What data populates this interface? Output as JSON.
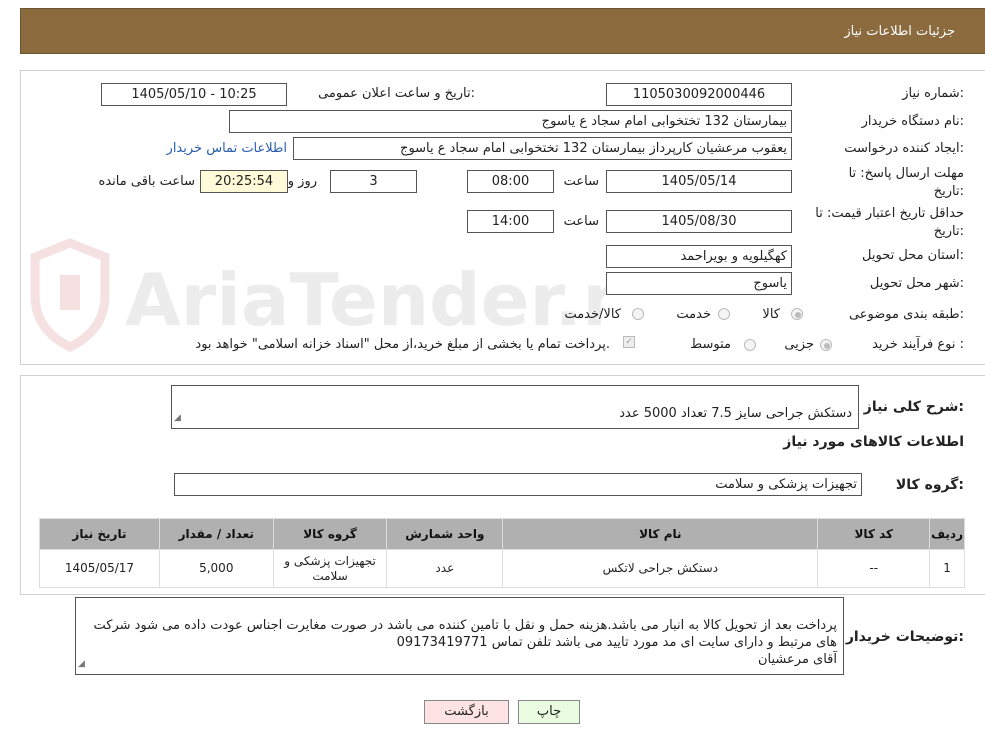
{
  "header": {
    "title": "جزئیات اطلاعات نیاز"
  },
  "watermark": {
    "text": "AriaTender.neT"
  },
  "form": {
    "need_number": {
      "label": "شماره نیاز:",
      "value": "1105030092000446"
    },
    "announce": {
      "label": "تاریخ و ساعت اعلان عمومی:",
      "value": "1405/05/10 - 10:25"
    },
    "buyer_org": {
      "label": "نام دستگاه خریدار:",
      "value": "بیمارستان 132 تختخوابی امام سجاد  ع  یاسوج"
    },
    "requester": {
      "label": "ایجاد کننده درخواست:",
      "value": "یعقوب مرعشیان کارپرداز بیمارستان 132 تختخوابی امام سجاد  ع  یاسوج",
      "contact_link": "اطلاعات تماس خریدار"
    },
    "deadline": {
      "label_line1": "مهلت ارسال پاسخ: تا",
      "label_line2": "تاریخ:",
      "date": "1405/05/14",
      "time_label": "ساعت",
      "time": "08:00",
      "days": "3",
      "days_label": "روز و",
      "remaining": "20:25:54",
      "remaining_label": "ساعت باقی مانده"
    },
    "validity": {
      "label_line1": "حداقل تاریخ اعتبار قیمت: تا",
      "label_line2": "تاریخ:",
      "date": "1405/08/30",
      "time_label": "ساعت",
      "time": "14:00"
    },
    "province": {
      "label": "استان محل تحویل:",
      "value": "کهگیلویه و بویراحمد"
    },
    "city": {
      "label": "شهر محل تحویل:",
      "value": "یاسوج"
    },
    "category": {
      "label": "طبقه بندی موضوعی:",
      "options": [
        "کالا",
        "خدمت",
        "کالا/خدمت"
      ],
      "selected": "کالا"
    },
    "process": {
      "label": "نوع فرآیند خرید :",
      "options": [
        "جزیی",
        "متوسط"
      ],
      "selected": "جزیی",
      "treasury_note": "پرداخت تمام یا بخشی از مبلغ خرید،از محل \"اسناد خزانه اسلامی\" خواهد بود."
    }
  },
  "description": {
    "label": "شرح کلی نیاز:",
    "value": "دستکش جراحی سایز 7.5  تعداد 5000 عدد"
  },
  "goods_info": {
    "title": "اطلاعات کالاهای مورد نیاز",
    "group_label": "گروه کالا:",
    "group_value": "تجهیزات پزشکی و سلامت"
  },
  "table": {
    "headers": [
      "ردیف",
      "کد کالا",
      "نام کالا",
      "واحد شمارش",
      "گروه کالا",
      "تعداد / مقدار",
      "تاریخ نیاز"
    ],
    "rows": [
      [
        "1",
        "--",
        "دستکش جراحی لاتکس",
        "عدد",
        "تجهیزات پزشکی و سلامت",
        "5,000",
        "1405/05/17"
      ]
    ]
  },
  "buyer_notes": {
    "label": "توضیحات خریدار:",
    "value": "پرداخت بعد از تحویل کالا به انبار می باشد.هزینه حمل و نقل با تامین کننده می باشد در صورت مغایرت اجناس عودت داده می شود شرکت های مرتبط و دارای سایت ای مد مورد تایید می باشد تلفن تماس 09173419771\nآقای مرعشیان"
  },
  "buttons": {
    "print": "چاپ",
    "back": "بازگشت"
  },
  "colors": {
    "header_bg": "#8b6a3e",
    "link": "#2a5db0",
    "table_header": "#b0b0b0",
    "print_bg": "#e9fbe0",
    "back_bg": "#fde3e3"
  }
}
